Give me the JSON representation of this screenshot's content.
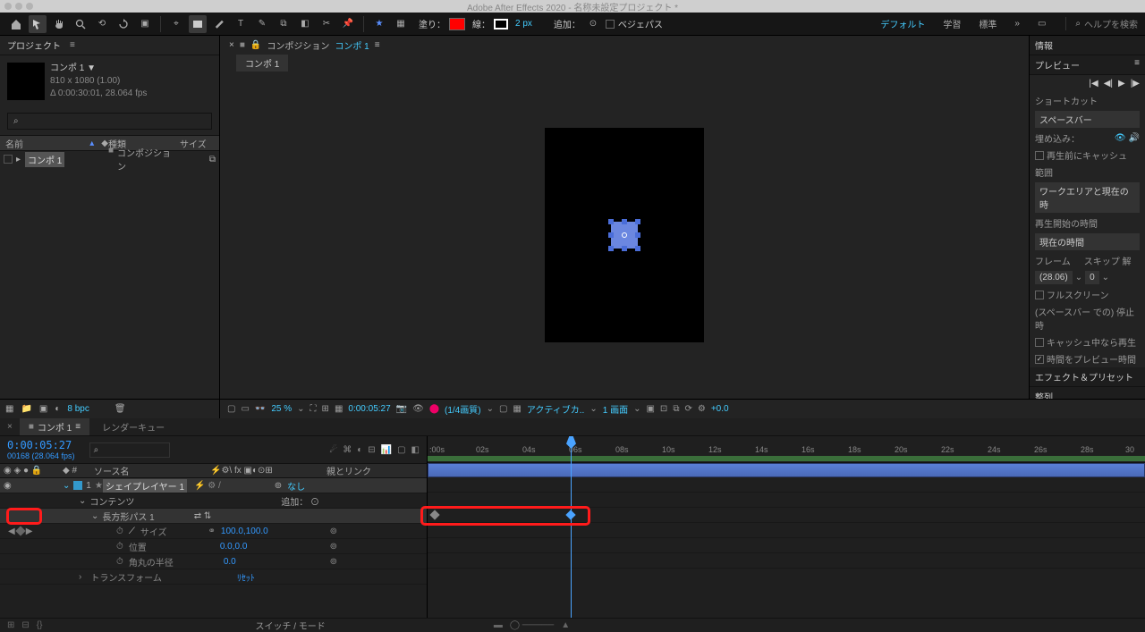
{
  "app": {
    "title": "Adobe After Effects 2020 - 名称未設定プロジェクト *"
  },
  "toolbar": {
    "fill_label": "塗り：",
    "stroke_label": "線：",
    "stroke_px": "2 px",
    "add_label": "追加：",
    "bezier_label": "ベジェパス",
    "workspaces": [
      "デフォルト",
      "学習",
      "標準"
    ],
    "search_placeholder": "ヘルプを検索"
  },
  "project": {
    "title": "プロジェクト",
    "comp_name": "コンポ 1 ▼",
    "dims": "810 x 1080 (1.00)",
    "dur": "Δ 0:00:30:01, 28.064 fps",
    "cols": {
      "name": "名前",
      "type": "種類",
      "size": "サイズ"
    },
    "item": {
      "name": "コンポ 1",
      "type": "コンポジション"
    }
  },
  "comp": {
    "breadcrumb_pre": "コンポジション ",
    "breadcrumb": "コンポ 1",
    "tab": "コンポ 1"
  },
  "footerbar": {
    "bpc": "8 bpc",
    "zoom": "25 %",
    "tc": "0:00:05:27",
    "quality": "(1/4画質)",
    "camera": "アクティブカ..",
    "view": "1 画面",
    "exposure": "+0.0"
  },
  "right": {
    "info": "情報",
    "preview": "プレビュー",
    "shortcut": "ショートカット",
    "spacebar": "スペースバー",
    "embed": "埋め込み：",
    "cache_before": "再生前にキャッシュ",
    "range": "範囲",
    "workarea_current": "ワークエリアと現在の時",
    "play_from": "再生開始の時間",
    "current_time": "現在の時間",
    "frame": "フレーム",
    "skip": "スキップ 解",
    "fps_val": "(28.06)",
    "skip_val": "0",
    "fullscreen": "フルスクリーン",
    "pause_at": "(スペースバー での) 停止時",
    "play_if_cached": "キャッシュ中なら再生",
    "time_as_preview": "時間をプレビュー時間",
    "effects": "エフェクト＆プリセット",
    "align": "整列"
  },
  "timeline": {
    "tab": "コンポ 1",
    "tab2": "レンダーキュー",
    "tc": "0:00:05:27",
    "frames": "00168 (28.064 fps)",
    "cols": {
      "src": "ソース名",
      "parent": "親とリンク",
      "add": "追加："
    },
    "layer": {
      "num": "1",
      "name": "シェイプレイヤー 1",
      "parent": "なし"
    },
    "contents": "コンテンツ",
    "rect_path": "長方形パス 1",
    "props": {
      "size": "サイズ",
      "size_v": "100.0,100.0",
      "pos": "位置",
      "pos_v": "0.0,0.0",
      "round": "角丸の半径",
      "round_v": "0.0"
    },
    "transform": "トランスフォーム",
    "reset": "ﾘｾｯﾄ",
    "ruler": [
      ":00s",
      "02s",
      "04s",
      "06s",
      "08s",
      "10s",
      "12s",
      "14s",
      "16s",
      "18s",
      "20s",
      "22s",
      "24s",
      "26s",
      "28s",
      "30"
    ],
    "switches": "スイッチ / モード"
  }
}
